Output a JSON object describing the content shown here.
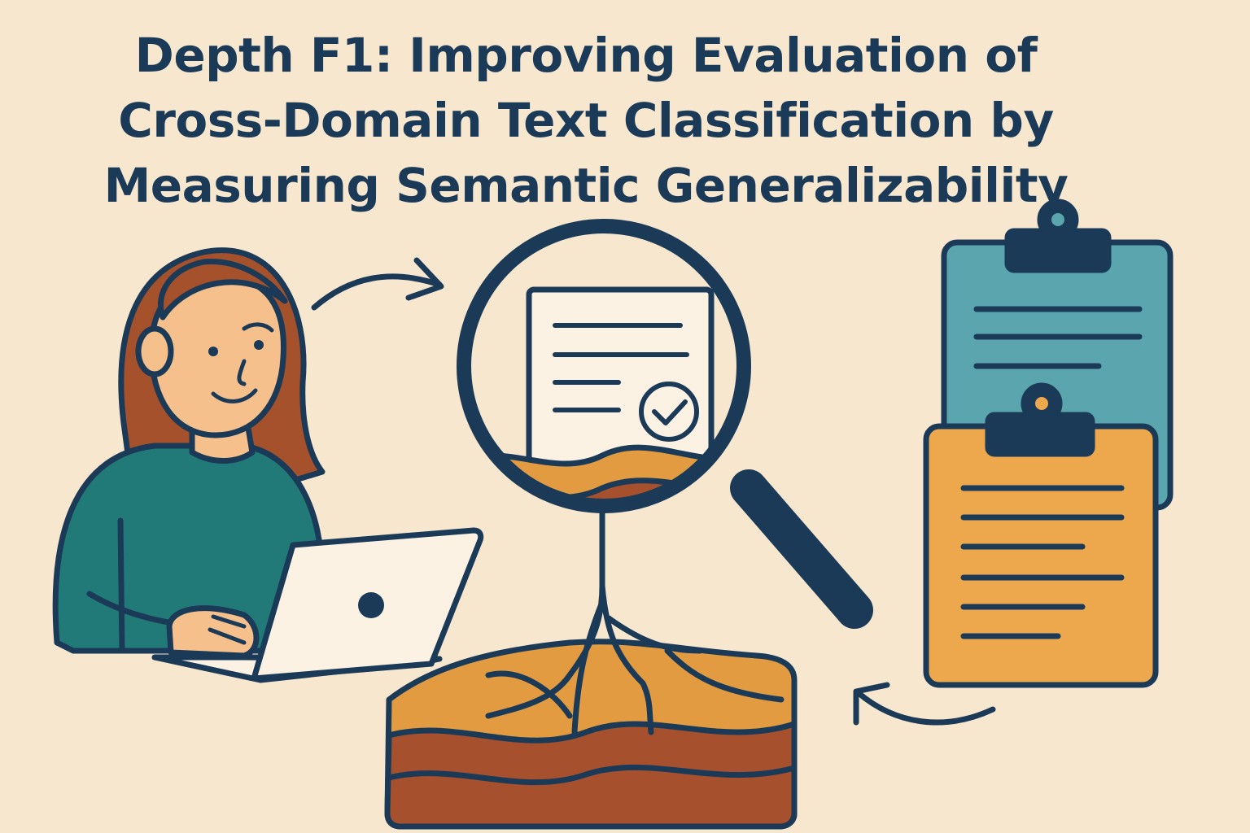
{
  "title": {
    "lines": [
      "Depth F1: Improving Evaluation of",
      "Cross-Domain Text Classification by",
      "Measuring Semantic Generalizability"
    ]
  },
  "colors": {
    "background": "#f8e7cf",
    "ink": "#1b3a57",
    "teal": "#227a78",
    "hair": "#a4512c",
    "skin": "#f6c08c",
    "clipboard_blue": "#5aa5ae",
    "clipboard_orange": "#eda84e",
    "soil_orange": "#e29b41",
    "soil_brown": "#a6502d",
    "paper": "#fbf2e4"
  },
  "icons": [
    "person-icon",
    "laptop-icon",
    "magnifier-icon",
    "document-check-icon",
    "clipboard-icon",
    "arrow-icon",
    "soil-roots-icon"
  ]
}
